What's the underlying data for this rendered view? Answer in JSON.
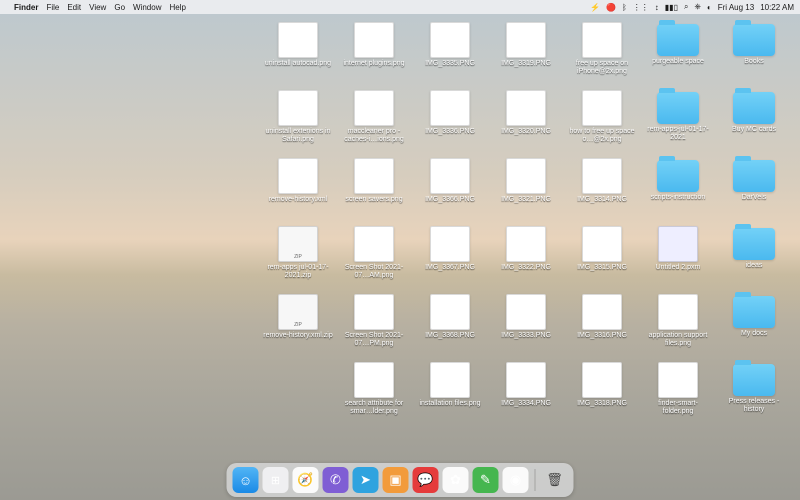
{
  "menubar": {
    "apple": "",
    "app": "Finder",
    "items": [
      "File",
      "Edit",
      "View",
      "Go",
      "Window",
      "Help"
    ],
    "status": {
      "bolt": "⚡",
      "red": "🔴",
      "bt": "ᛒ",
      "wifi": "⋮⋮",
      "updown": "↕",
      "bat": "▮▮▯",
      "search": "⌕",
      "ctrl": "⎈",
      "toggle": "◐",
      "date": "Fri Aug 13",
      "time": "10:22 AM"
    }
  },
  "grid": [
    [
      {
        "t": "img",
        "l": "uninstall autocad.png"
      },
      {
        "t": "img",
        "l": "internet plugins.png"
      },
      {
        "t": "img",
        "l": "IMG_3335.PNG"
      },
      {
        "t": "img",
        "l": "IMG_3319.PNG"
      },
      {
        "t": "img",
        "l": "free up space on iPhone@2x.png"
      },
      {
        "t": "folder",
        "l": "purgeable space"
      },
      {
        "t": "folder",
        "l": "Books"
      }
    ],
    [
      {
        "t": "img",
        "l": "uninstall extenions in Safari.png"
      },
      {
        "t": "img",
        "l": "maccleaner pro - caches-i…ions.png"
      },
      {
        "t": "img",
        "l": "IMG_3336.PNG"
      },
      {
        "t": "img",
        "l": "IMG_3320.PNG"
      },
      {
        "t": "img",
        "l": "how to free up space o…@2x.png"
      },
      {
        "t": "folder",
        "l": "rem-apps-jul-01-17-2021"
      },
      {
        "t": "folder",
        "l": "Buy MC cards"
      }
    ],
    [
      {
        "t": "doc",
        "l": "remove-history.xml"
      },
      {
        "t": "img",
        "l": "screen savers.png"
      },
      {
        "t": "img",
        "l": "IMG_3366.PNG"
      },
      {
        "t": "img",
        "l": "IMG_3321.PNG"
      },
      {
        "t": "img",
        "l": "IMG_3314.PNG"
      },
      {
        "t": "folder",
        "l": "scripts-instruction"
      },
      {
        "t": "folder",
        "l": "DarVels"
      }
    ],
    [
      {
        "t": "zip",
        "l": "rem-apps jul-01-17-2021.zip"
      },
      {
        "t": "img",
        "l": "Screen Shot 2021-07…AM.png"
      },
      {
        "t": "img",
        "l": "IMG_3367.PNG"
      },
      {
        "t": "img",
        "l": "IMG_3322.PNG"
      },
      {
        "t": "img",
        "l": "IMG_3315.PNG"
      },
      {
        "t": "pxm",
        "l": "Untitled 2.pxm"
      },
      {
        "t": "folder",
        "l": "ideas"
      }
    ],
    [
      {
        "t": "zip",
        "l": "remove-history.xml.zip"
      },
      {
        "t": "img",
        "l": "Screen Shot 2021-07…PM.png"
      },
      {
        "t": "img",
        "l": "IMG_3368.PNG"
      },
      {
        "t": "img",
        "l": "IMG_3333.PNG"
      },
      {
        "t": "img",
        "l": "IMG_3316.PNG"
      },
      {
        "t": "img",
        "l": "application support files.png"
      },
      {
        "t": "folder",
        "l": "My docs"
      }
    ],
    [
      {
        "t": "empty"
      },
      {
        "t": "img",
        "l": "search attribute for smar…lder.png"
      },
      {
        "t": "img",
        "l": "installation files.png"
      },
      {
        "t": "img",
        "l": "IMG_3334.PNG"
      },
      {
        "t": "img",
        "l": "IMG_3318.PNG"
      },
      {
        "t": "img",
        "l": "finder-smart-folder.png"
      },
      {
        "t": "folder",
        "l": "Press releases - history"
      }
    ]
  ],
  "dock": [
    {
      "n": "finder",
      "c": "dock-finder",
      "g": "☺"
    },
    {
      "n": "launchpad",
      "c": "dock-launchpad",
      "g": "⊞"
    },
    {
      "n": "safari",
      "c": "dock-safari",
      "g": "🧭"
    },
    {
      "n": "viber",
      "c": "dock-viber",
      "g": "✆"
    },
    {
      "n": "telegram",
      "c": "dock-telegram",
      "g": "➤"
    },
    {
      "n": "app-orange",
      "c": "dock-orange",
      "g": "▣"
    },
    {
      "n": "app-red",
      "c": "dock-red",
      "g": "💬"
    },
    {
      "n": "photos",
      "c": "dock-photos",
      "g": "✿"
    },
    {
      "n": "evernote",
      "c": "dock-evernote",
      "g": "✎"
    },
    {
      "n": "chrome",
      "c": "dock-chrome",
      "g": "◉"
    }
  ],
  "trash": "🗑"
}
